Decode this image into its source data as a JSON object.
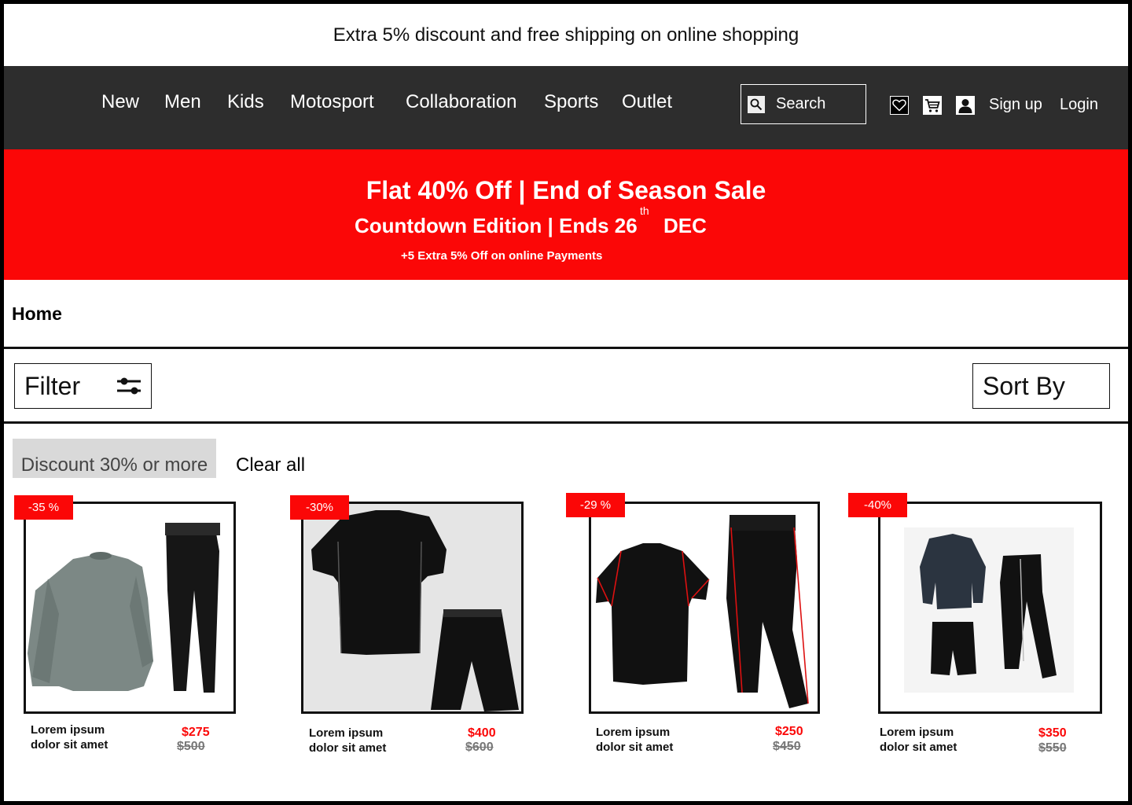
{
  "promo": {
    "text": "Extra 5% discount and free shipping on online shopping"
  },
  "nav": {
    "items": [
      "New",
      "Men",
      "Kids",
      "Motosport",
      "Collaboration",
      "Sports",
      "Outlet"
    ],
    "search_label": "Search",
    "signup_label": "Sign up",
    "login_label": "Login"
  },
  "banner": {
    "headline": "Flat 40% Off | End of Season Sale",
    "subline": "Countdown Edition | Ends 26",
    "sup": "th",
    "month": "DEC",
    "note": "+5 Extra 5% Off on online Payments"
  },
  "breadcrumb": "Home",
  "toolbar": {
    "filter_label": "Filter",
    "sort_label": "Sort By"
  },
  "chips": {
    "active": "Discount 30% or more",
    "clear_label": "Clear all"
  },
  "products": [
    {
      "badge": "-35 %",
      "name_line1": "Lorem ipsum",
      "name_line2": "dolor sit amet",
      "price": "$275",
      "old_price": "$500"
    },
    {
      "badge": "-30%",
      "name_line1": "Lorem ipsum",
      "name_line2": "dolor sit amet",
      "price": "$400",
      "old_price": "$600"
    },
    {
      "badge": "-29 %",
      "name_line1": "Lorem ipsum",
      "name_line2": "dolor sit amet",
      "price": "$250",
      "old_price": "$450"
    },
    {
      "badge": "-40%",
      "name_line1": "Lorem ipsum",
      "name_line2": "dolor sit amet",
      "price": "$350",
      "old_price": "$550"
    }
  ],
  "colors": {
    "accent": "#fb0707",
    "nav_bg": "#2d2d2d",
    "chip_bg": "#d9d9d9"
  },
  "icons": [
    "search-icon",
    "heart-icon",
    "cart-icon",
    "user-icon",
    "sliders-icon"
  ]
}
